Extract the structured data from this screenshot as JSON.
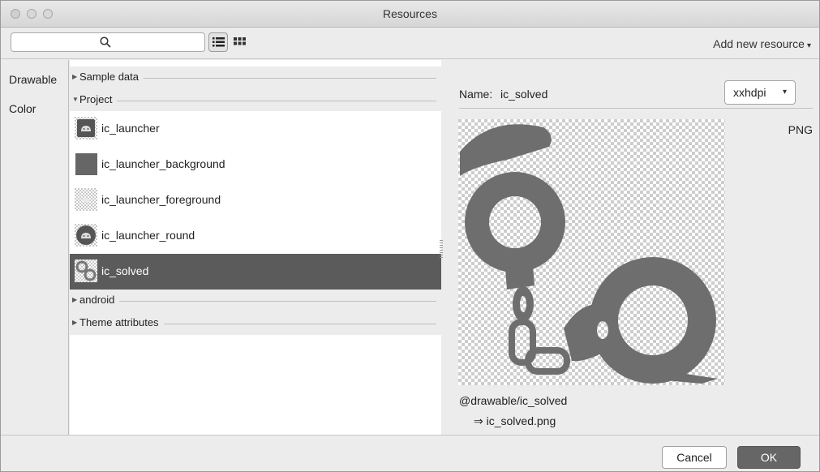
{
  "window": {
    "title": "Resources"
  },
  "toolbar": {
    "search_placeholder": "",
    "search_icon": "search-icon",
    "list_view_icon": "list-view-icon",
    "grid_view_icon": "grid-view-icon",
    "add_resource_label": "Add new resource",
    "add_resource_caret": "▾"
  },
  "nav": {
    "items": [
      {
        "label": "Drawable"
      },
      {
        "label": "Color"
      }
    ]
  },
  "list": {
    "groups": [
      {
        "label": "Sample data",
        "expanded": false
      },
      {
        "label": "Project",
        "expanded": true
      },
      {
        "label": "android",
        "expanded": false
      },
      {
        "label": "Theme attributes",
        "expanded": false
      }
    ],
    "items": [
      {
        "name": "ic_launcher",
        "icon": "android-launcher-icon"
      },
      {
        "name": "ic_launcher_background",
        "icon": "background-swatch-icon"
      },
      {
        "name": "ic_launcher_foreground",
        "icon": "foreground-checker-icon"
      },
      {
        "name": "ic_launcher_round",
        "icon": "android-round-icon"
      },
      {
        "name": "ic_solved",
        "icon": "handcuffs-icon",
        "selected": true
      }
    ]
  },
  "details": {
    "name_label": "Name:",
    "name_value": "ic_solved",
    "density": "xxhdpi",
    "density_caret": "▾",
    "file_type": "PNG",
    "preview_icon": "handcuffs-icon",
    "resource_path": "@drawable/ic_solved",
    "file_name": "⇒ ic_solved.png"
  },
  "footer": {
    "cancel_label": "Cancel",
    "ok_label": "OK"
  },
  "colors": {
    "selection": "#5b5b5b",
    "preview_shape": "#6e6e6e",
    "ok_button": "#666666"
  }
}
